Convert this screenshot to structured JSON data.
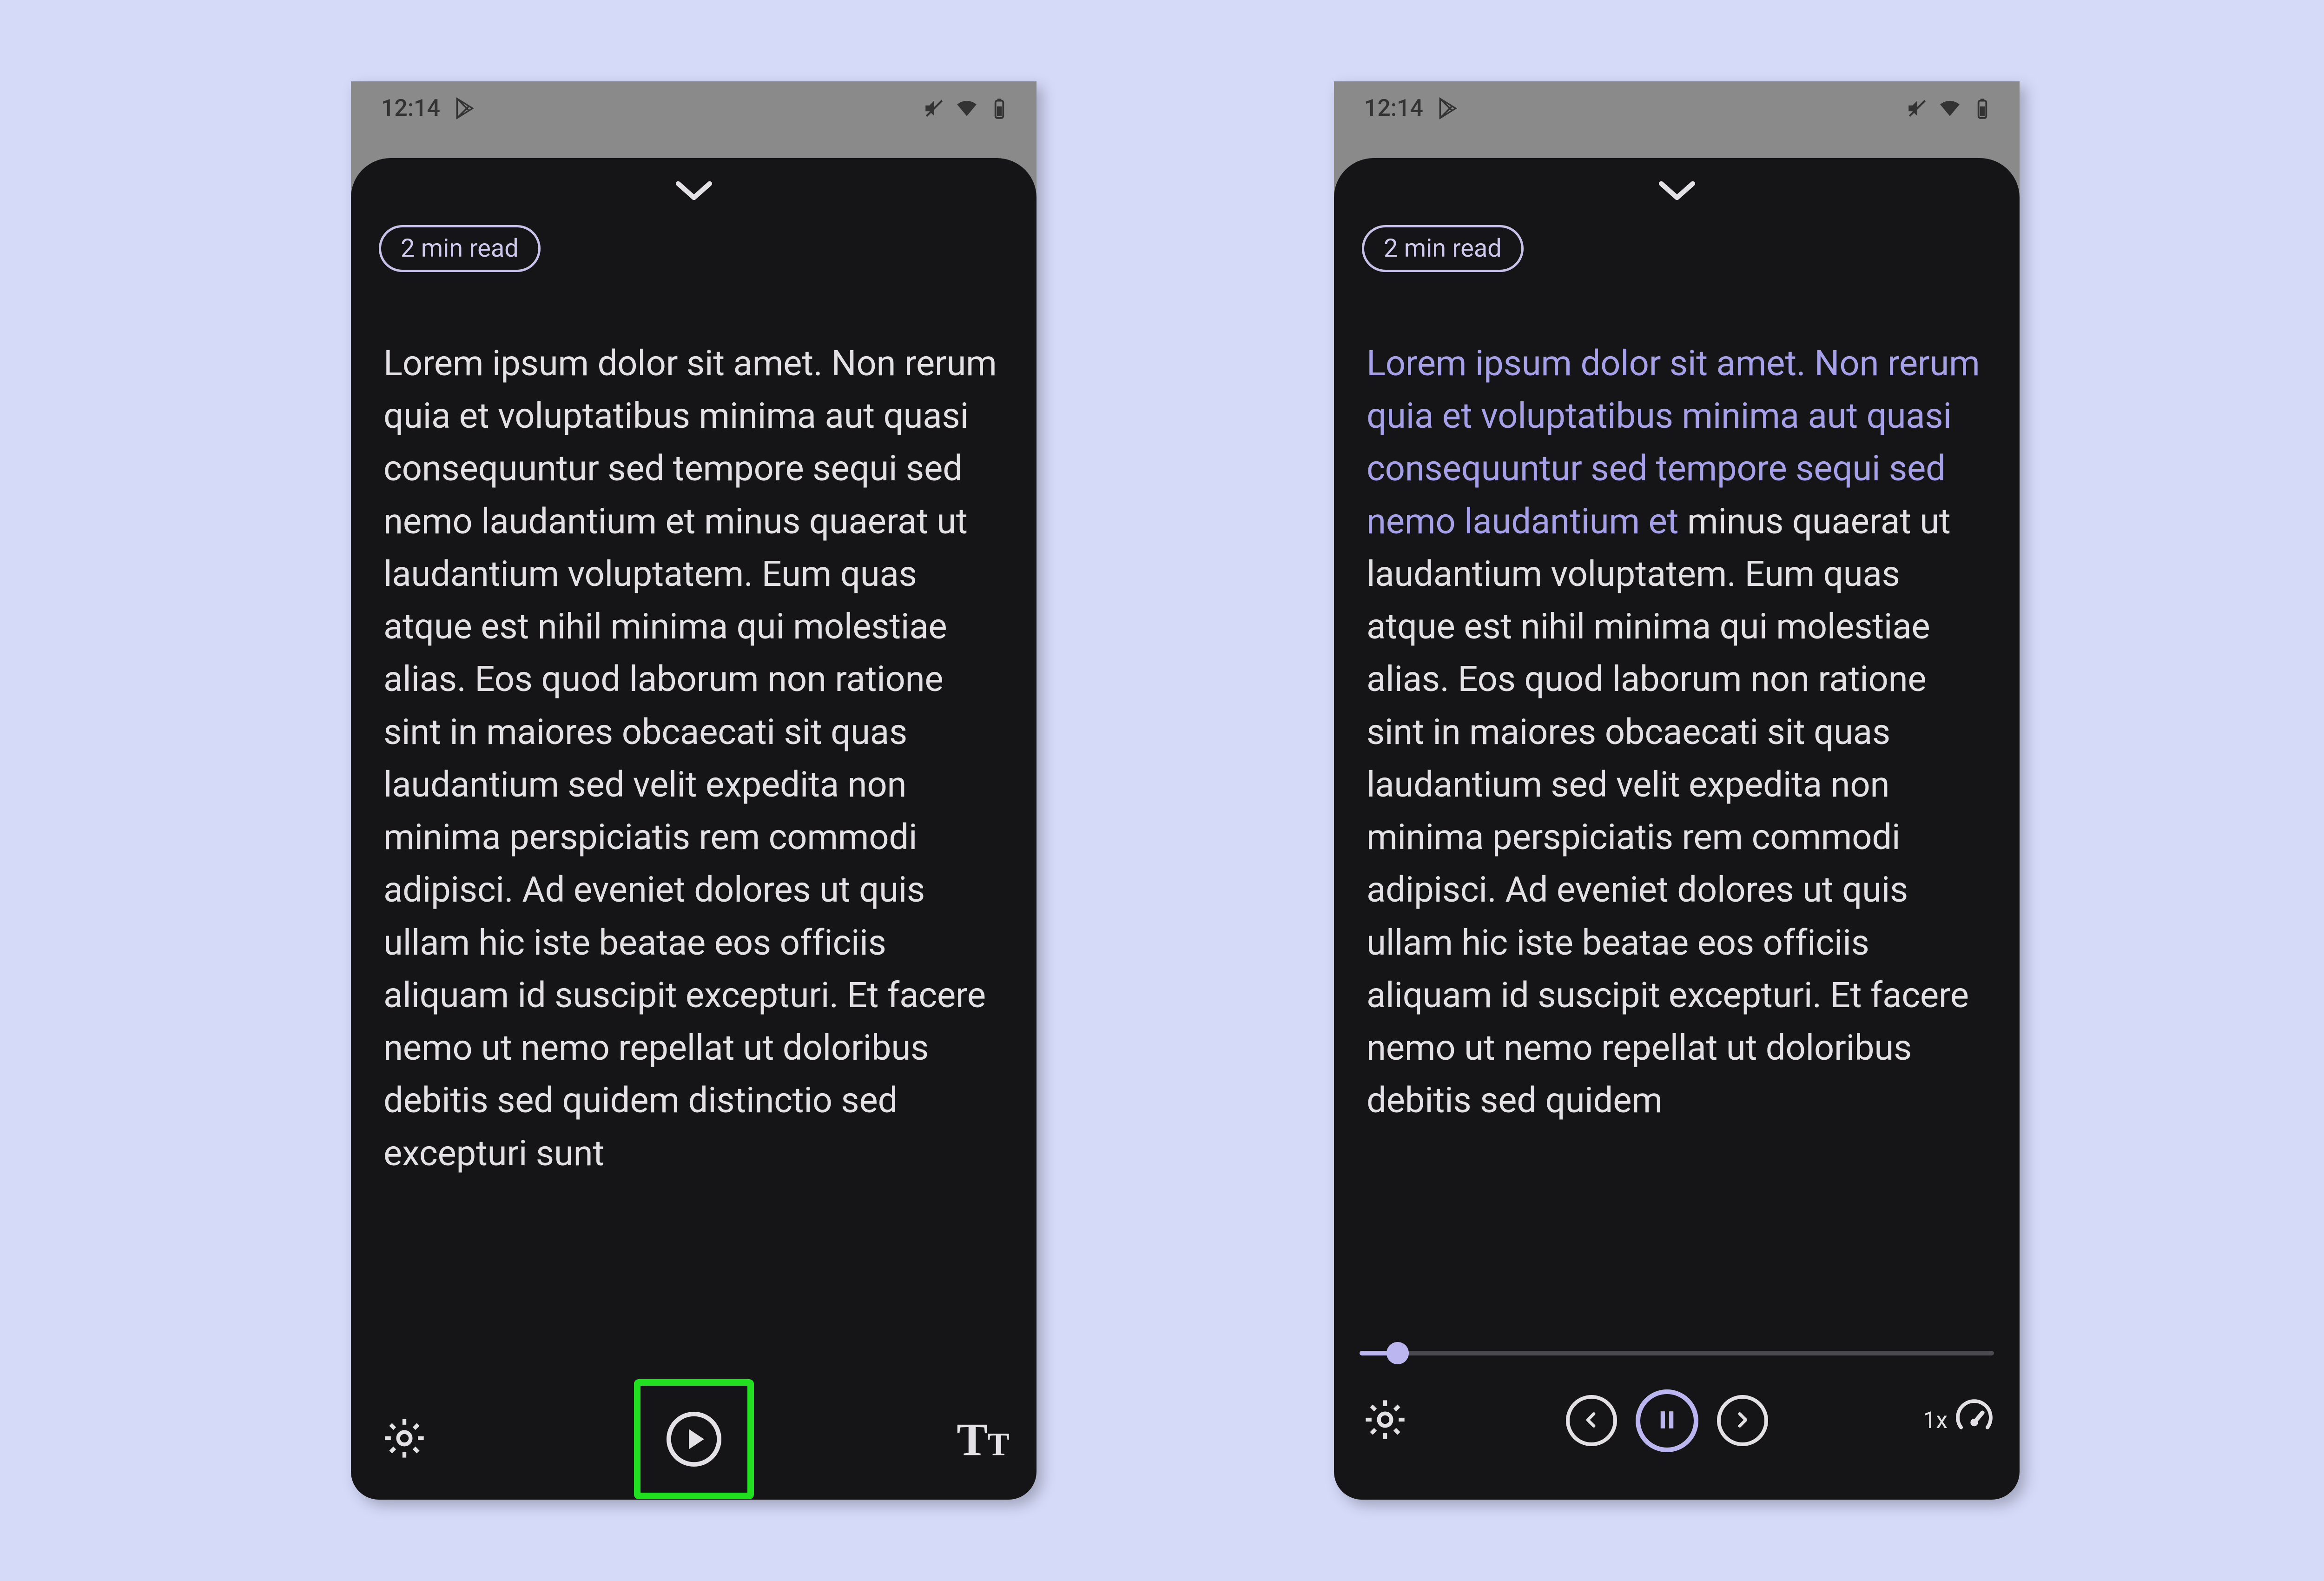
{
  "statusbar": {
    "time": "12:14"
  },
  "reader": {
    "read_time": "2 min read",
    "body_plain": "Lorem ipsum dolor sit amet. Non rerum quia et voluptatibus minima aut quasi consequuntur sed tempore sequi sed nemo laudantium et minus quaerat ut laudantium voluptatem. Eum quas atque est nihil minima qui molestiae alias. Eos quod laborum non ratione sint in maiores obcaecati sit quas laudantium sed velit expedita non minima perspiciatis rem commodi adipisci. Ad eveniet dolores ut quis ullam hic iste beatae eos officiis aliquam id suscipit excepturi. Et facere nemo ut nemo repellat ut doloribus debitis sed quidem distinctio sed excepturi sunt",
    "body_highlighted": "Lorem ipsum dolor sit amet. Non rerum quia et voluptatibus minima aut quasi consequuntur sed tempore sequi sed nemo laudantium et ",
    "body_remaining": "minus quaerat ut laudantium voluptatem. Eum quas atque est nihil minima qui molestiae alias. Eos quod laborum non ratione sint in maiores obcaecati sit quas laudantium sed velit expedita non minima perspiciatis rem commodi adipisci. Ad eveniet dolores ut quis ullam hic iste beatae eos officiis aliquam id suscipit excepturi. Et facere nemo ut nemo repellat ut doloribus debitis sed quidem"
  },
  "playback": {
    "speed_label": "1x",
    "progress_percent": 6
  }
}
